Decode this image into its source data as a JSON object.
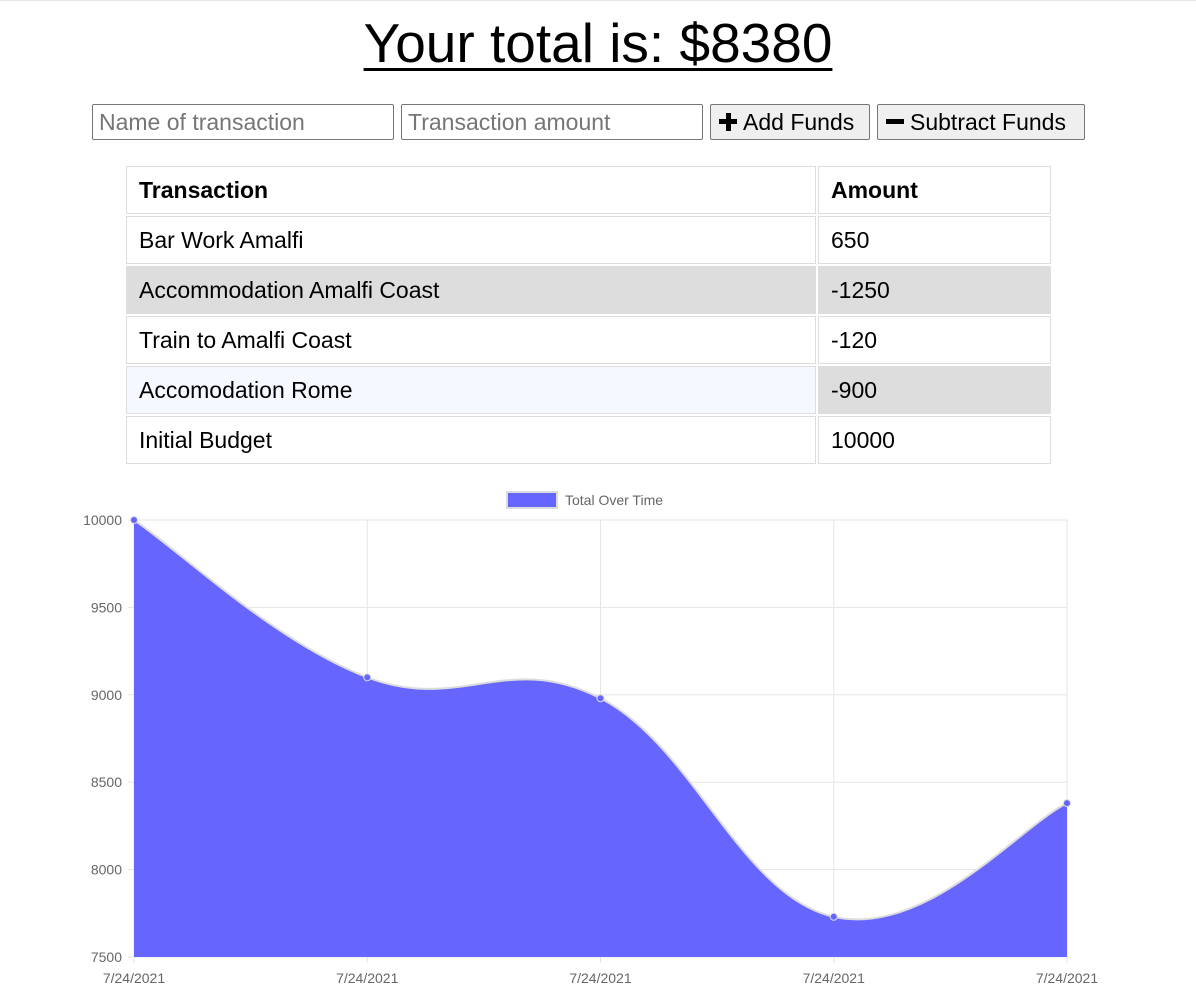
{
  "header": {
    "title": "Your total is: $8380"
  },
  "form": {
    "name_placeholder": "Name of transaction",
    "amount_placeholder": "Transaction amount",
    "add_label": "Add Funds",
    "subtract_label": "Subtract Funds"
  },
  "table": {
    "headers": [
      "Transaction",
      "Amount"
    ],
    "rows": [
      {
        "name": "Bar Work Amalfi",
        "amount": "650"
      },
      {
        "name": "Accommodation Amalfi Coast",
        "amount": "-1250"
      },
      {
        "name": "Train to Amalfi Coast",
        "amount": "-120"
      },
      {
        "name": "Accomodation Rome",
        "amount": "-900"
      },
      {
        "name": "Initial Budget",
        "amount": "10000"
      }
    ]
  },
  "colors": {
    "area_fill": "#6666ff",
    "area_stroke": "#dcdcdc",
    "row_highlight": "#dddddd"
  },
  "chart_data": {
    "type": "area",
    "x": [
      "7/24/2021",
      "7/24/2021",
      "7/24/2021",
      "7/24/2021",
      "7/24/2021"
    ],
    "series": [
      {
        "name": "Total Over Time",
        "values": [
          10000,
          9100,
          8980,
          7730,
          8380
        ]
      }
    ],
    "yticks": [
      10000,
      9500,
      9000,
      8500,
      8000,
      7500
    ],
    "ylim": [
      7500,
      10000
    ],
    "grid": true,
    "legend": "top-center"
  }
}
